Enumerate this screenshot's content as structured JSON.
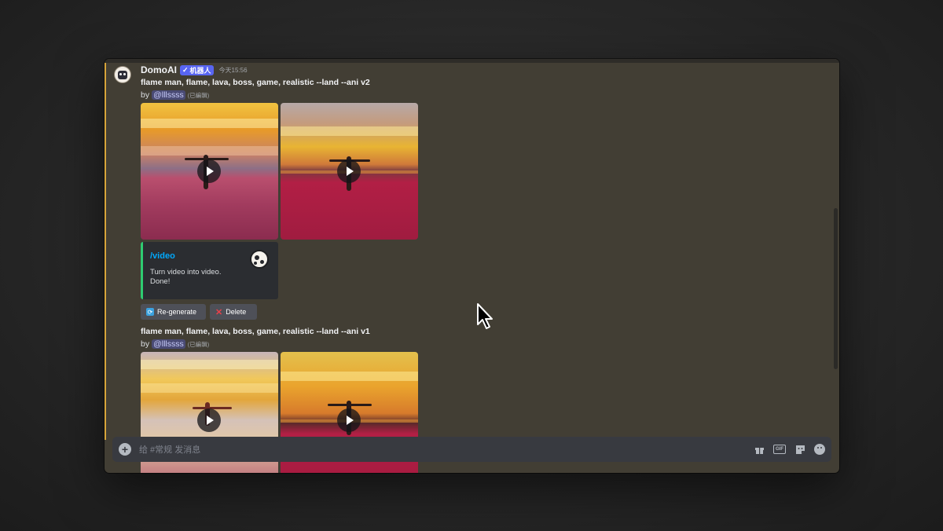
{
  "message": {
    "author": "DomoAI",
    "bot_badge": "机器人",
    "timestamp": "今天15:56",
    "posts": [
      {
        "prompt": "flame man, flame, lava, boss, game, realistic --land --ani v2",
        "by": "by",
        "mention": "@lllssss",
        "edited": "(已編輯)"
      },
      {
        "prompt": "flame man, flame, lava, boss, game, realistic --land --ani v1",
        "by": "by",
        "mention": "@lllssss",
        "edited": "(已編輯)"
      }
    ],
    "embed": {
      "title": "/video",
      "line1": "Turn video into video.",
      "line2": "Done!"
    },
    "buttons": {
      "regenerate": "Re-generate",
      "delete": "Delete"
    }
  },
  "composer": {
    "placeholder": "给 #常规 发消息",
    "icons": [
      "plus-icon",
      "gift-icon",
      "gif-icon",
      "sticker-icon",
      "emoji-icon"
    ],
    "gif_label": "GIF"
  },
  "colors": {
    "bot_badge": "#5865f2",
    "embed_border": "#2ecc71",
    "link": "#00a8fc",
    "highlight": "#d6a43a"
  }
}
